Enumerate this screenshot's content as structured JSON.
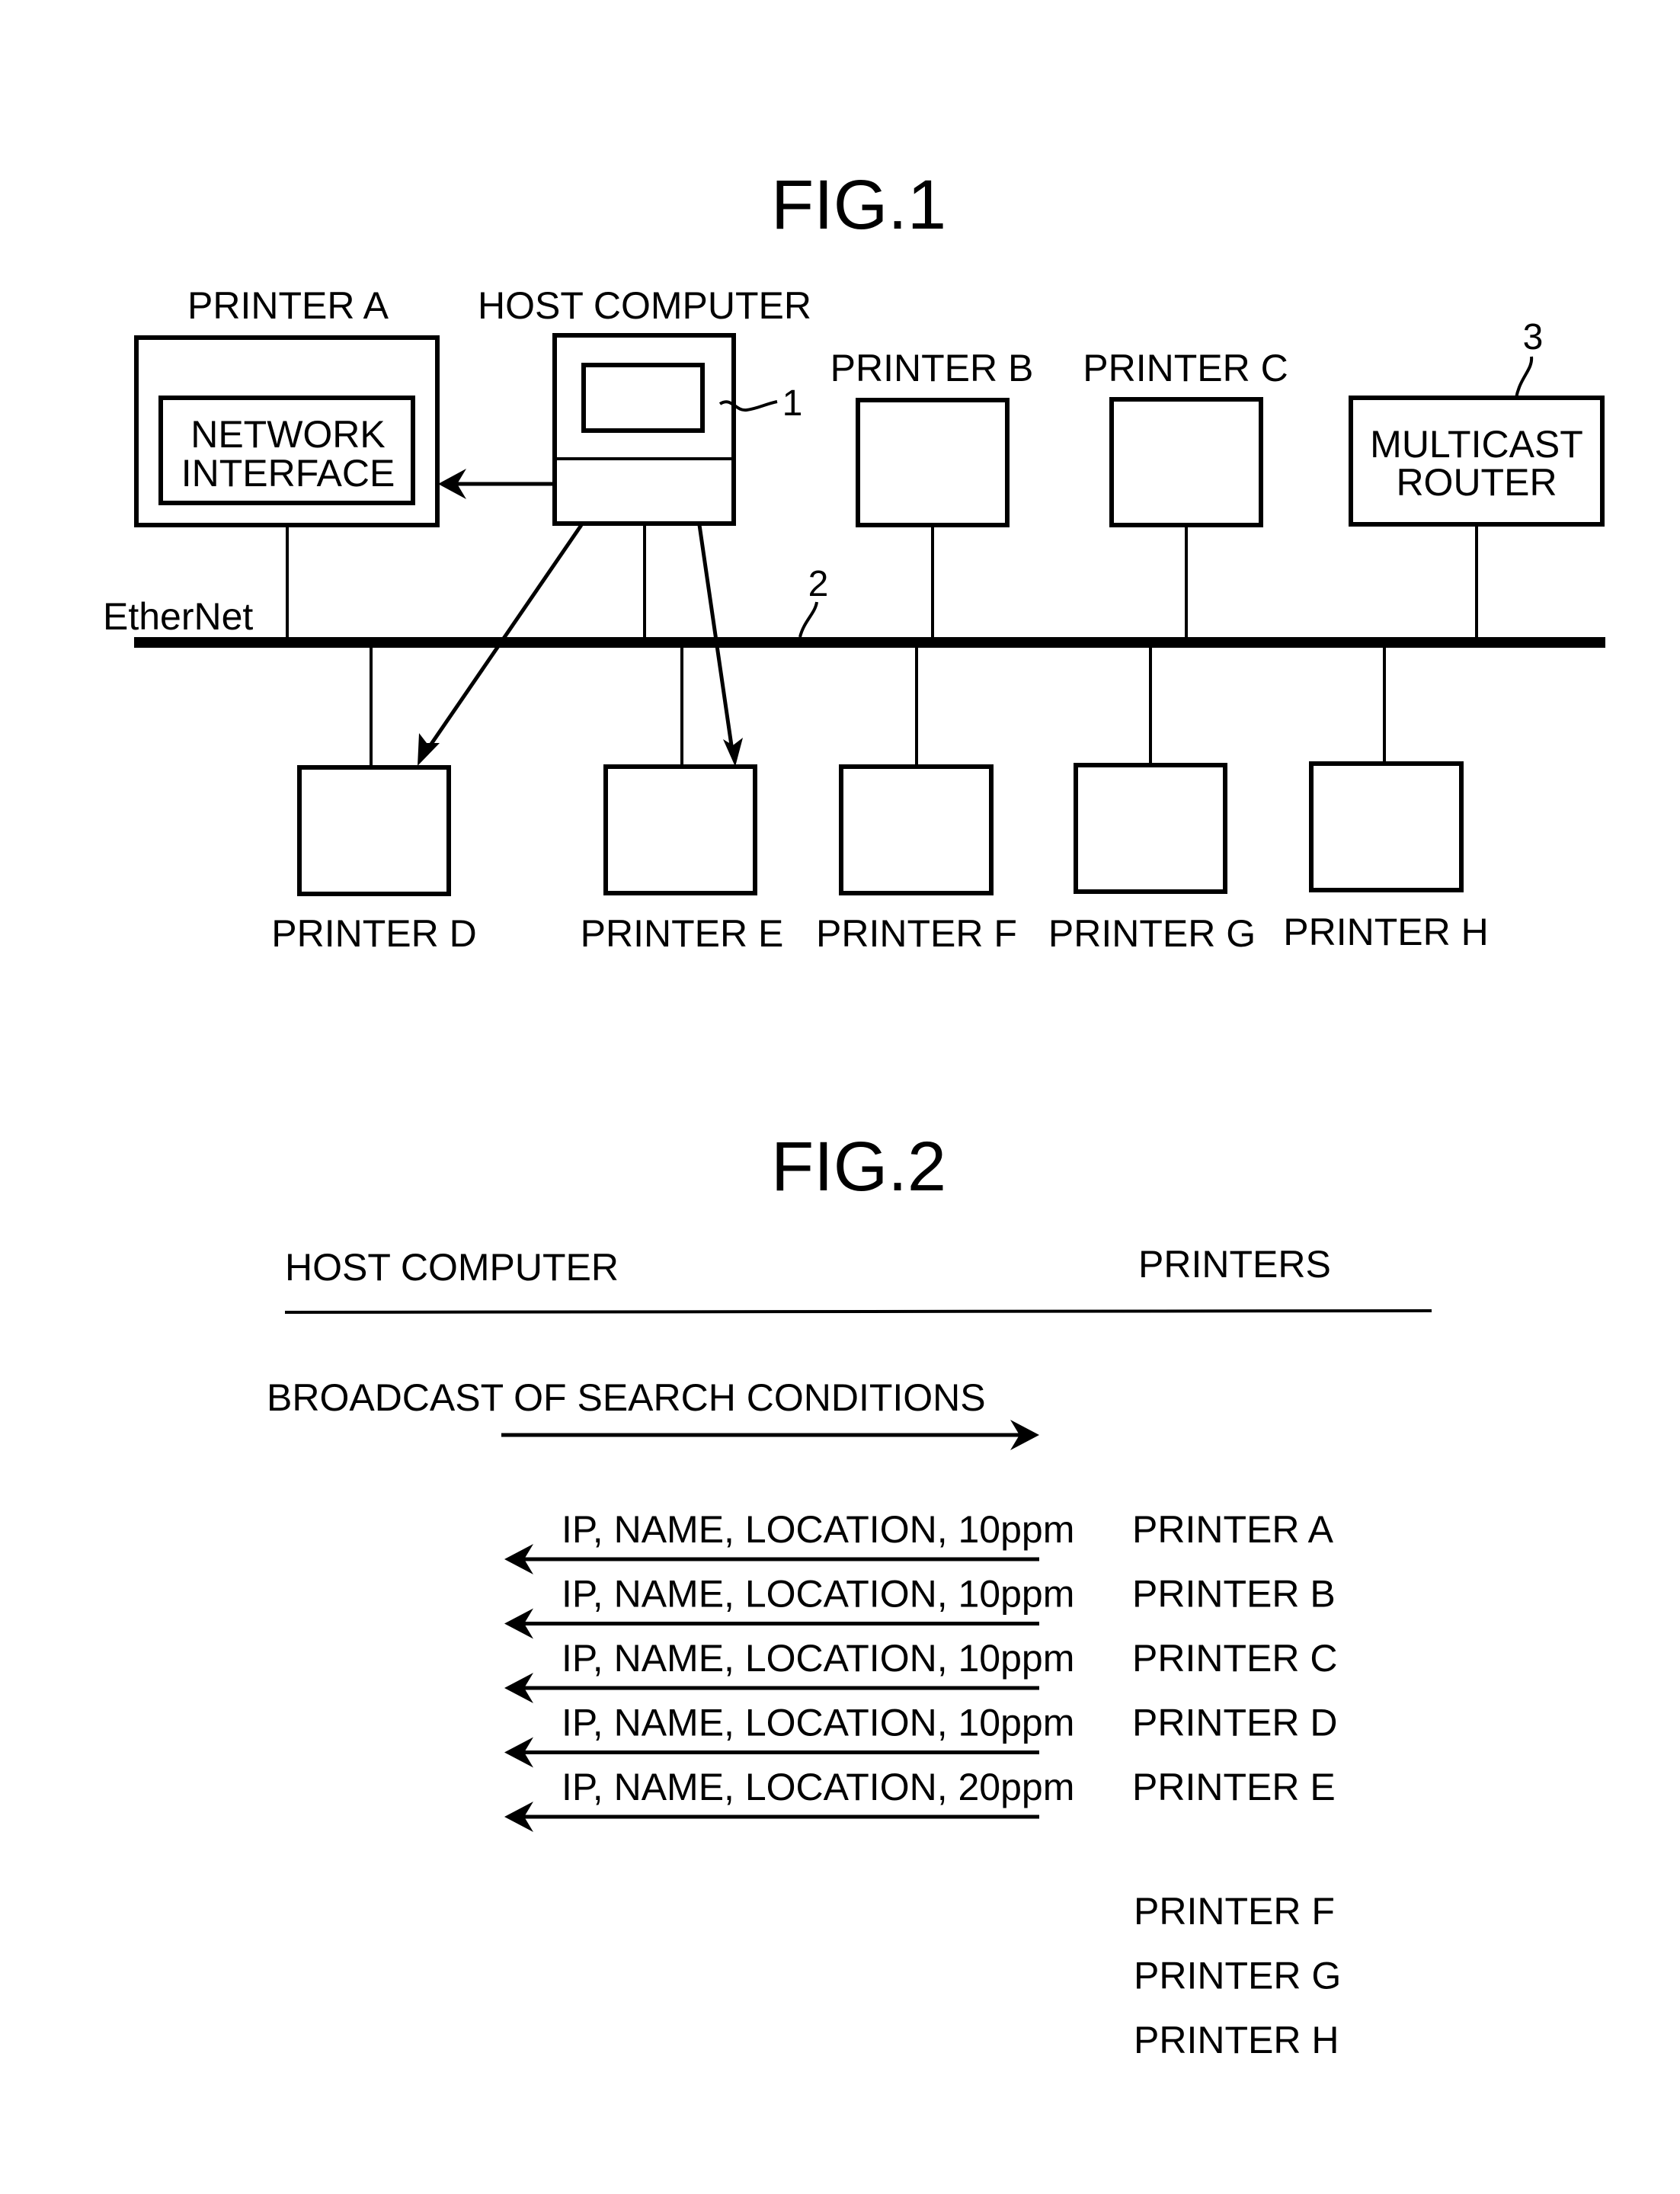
{
  "fig1": {
    "title": "FIG.1",
    "host_computer": {
      "label": "HOST COMPUTER",
      "ref_number": "1"
    },
    "network": {
      "label": "EtherNet",
      "ref_number": "2"
    },
    "router": {
      "label_line1": "MULTICAST",
      "label_line2": "ROUTER",
      "ref_number": "3"
    },
    "printer_a": {
      "label": "PRINTER A",
      "inner_line1": "NETWORK",
      "inner_line2": "INTERFACE"
    },
    "top_printers": [
      {
        "id": "b",
        "label": "PRINTER B"
      },
      {
        "id": "c",
        "label": "PRINTER C"
      }
    ],
    "bottom_printers": [
      {
        "id": "d",
        "label": "PRINTER D"
      },
      {
        "id": "e",
        "label": "PRINTER E"
      },
      {
        "id": "f",
        "label": "PRINTER F"
      },
      {
        "id": "g",
        "label": "PRINTER G"
      },
      {
        "id": "h",
        "label": "PRINTER H"
      }
    ]
  },
  "fig2": {
    "title": "FIG.2",
    "host_header": "HOST COMPUTER",
    "printers_header": "PRINTERS",
    "broadcast_label": "BROADCAST OF SEARCH CONDITIONS",
    "responses": [
      {
        "message": "IP, NAME, LOCATION, 10ppm",
        "printer": "PRINTER A"
      },
      {
        "message": "IP, NAME, LOCATION, 10ppm",
        "printer": "PRINTER B"
      },
      {
        "message": "IP, NAME, LOCATION, 10ppm",
        "printer": "PRINTER C"
      },
      {
        "message": "IP, NAME, LOCATION, 10ppm",
        "printer": "PRINTER D"
      },
      {
        "message": "IP, NAME, LOCATION, 20ppm",
        "printer": "PRINTER E"
      }
    ],
    "non_responding_printers": [
      "PRINTER F",
      "PRINTER G",
      "PRINTER H"
    ]
  }
}
